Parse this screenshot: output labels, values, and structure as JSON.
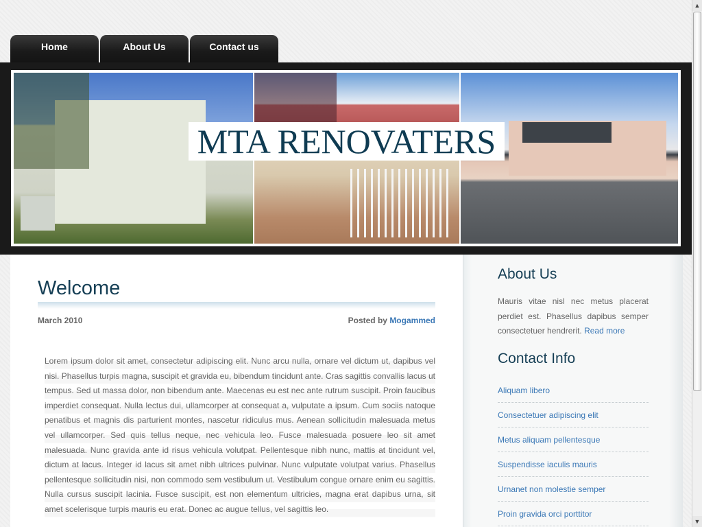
{
  "nav": {
    "items": [
      {
        "label": "Home"
      },
      {
        "label": "About Us"
      },
      {
        "label": "Contact us"
      }
    ]
  },
  "banner": {
    "title": "MTA RENOVATERS"
  },
  "post": {
    "title": "Welcome",
    "date": "March 2010",
    "posted_by_label": "Posted by",
    "author": "Mogammed",
    "body": "Lorem ipsum dolor sit amet, consectetur adipiscing elit. Nunc arcu nulla, ornare vel dictum ut, dapibus vel nisi. Phasellus turpis magna, suscipit et gravida eu, bibendum tincidunt ante. Cras sagittis convallis lacus ut tempus. Sed ut massa dolor, non bibendum ante. Maecenas eu est nec ante rutrum suscipit. Proin faucibus imperdiet consequat. Nulla lectus dui, ullamcorper at consequat a, vulputate a ipsum. Cum sociis natoque penatibus et magnis dis parturient montes, nascetur ridiculus mus. Aenean sollicitudin malesuada metus vel ullamcorper. Sed quis tellus neque, nec vehicula leo. Fusce malesuada posuere leo sit amet malesuada. Nunc gravida ante id risus vehicula volutpat. Pellentesque nibh nunc, mattis at tincidunt vel, dictum at lacus. Integer id lacus sit amet nibh ultrices pulvinar. Nunc vulputate volutpat varius. Phasellus pellentesque sollicitudin nisi, non commodo sem vestibulum ut. Vestibulum congue ornare enim eu sagittis. Nulla cursus suscipit lacinia. Fusce suscipit, est non elementum ultricies, magna erat dapibus urna, sit amet scelerisque turpis mauris eu erat. Donec ac augue tellus, vel sagittis leo."
  },
  "sidebar": {
    "about": {
      "title": "About Us",
      "text": "Mauris vitae nisl nec metus placerat perdiet est. Phasellus dapibus semper consectetuer hendrerit.",
      "read_more": "Read more"
    },
    "contact": {
      "title": "Contact Info",
      "links": [
        "Aliquam libero",
        "Consectetuer adipiscing elit",
        "Metus aliquam pellentesque",
        "Suspendisse iaculis mauris",
        "Urnanet non molestie semper",
        "Proin gravida orci porttitor"
      ]
    }
  },
  "colors": {
    "heading": "#163f55",
    "link": "#3b78b6",
    "banner_title": "#0f3b52",
    "nav_bg": "#1a1a1a"
  }
}
